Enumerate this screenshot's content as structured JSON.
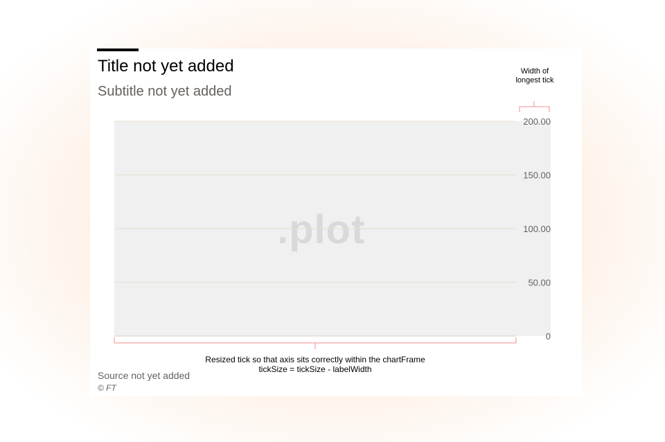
{
  "chart_data": {
    "type": "line",
    "title": "Title not yet added",
    "subtitle": "Subtitle not yet added",
    "y_ticks": [
      0,
      50,
      100,
      150,
      200
    ],
    "y_tick_labels": [
      "0",
      "50.00",
      "100.00",
      "150.00",
      "200.00"
    ],
    "ylim": [
      0,
      200
    ],
    "y_axis_side": "right",
    "grid": true,
    "series": [],
    "source": "Source not yet added",
    "footer": "© FT"
  },
  "watermark": ".plot",
  "annotations": {
    "top": "Width of longest tick",
    "bottom_line1": "Resized tick so that axis sits correctly within the chartFrame",
    "bottom_line2": "tickSize = tickSize - labelWidth"
  },
  "colors": {
    "background": "#ffffff",
    "plot_background": "#f0f0f1",
    "gridline": "#e9dccf",
    "annotation": "#f08c8c",
    "tick_text": "#66605c"
  }
}
